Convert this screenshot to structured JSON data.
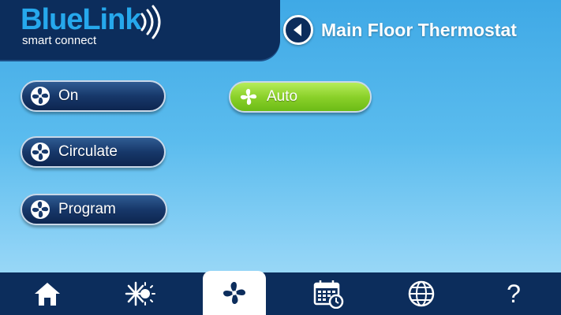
{
  "logo": {
    "brand": "BlueLink",
    "tagline": "smart connect"
  },
  "header": {
    "title": "Main Floor Thermostat",
    "back_icon": "back-arrow-icon"
  },
  "fan_modes": [
    {
      "label": "On",
      "selected": false
    },
    {
      "label": "Circulate",
      "selected": false
    },
    {
      "label": "Program",
      "selected": false
    },
    {
      "label": "Auto",
      "selected": true
    }
  ],
  "nav": {
    "items": [
      {
        "icon": "home-icon"
      },
      {
        "icon": "heat-cool-icon"
      },
      {
        "icon": "fan-icon",
        "active": true
      },
      {
        "icon": "schedule-icon"
      },
      {
        "icon": "globe-icon"
      },
      {
        "icon": "help-icon",
        "label": "?"
      }
    ]
  },
  "colors": {
    "navy": "#0c2d5c",
    "brand_blue": "#26a8ec",
    "selected_green": "#8bd12a",
    "sky": "#5bbcee"
  }
}
